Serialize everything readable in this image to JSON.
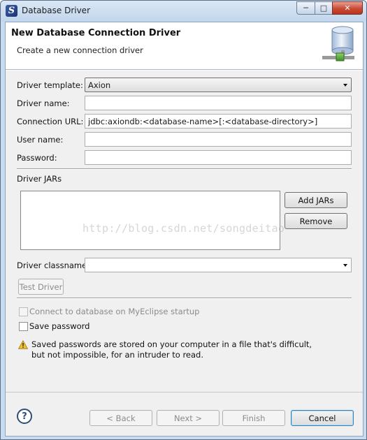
{
  "window": {
    "title": "Database Driver",
    "minimize_symbol": "─",
    "maximize_symbol": "□",
    "close_symbol": "✕"
  },
  "header": {
    "title": "New Database Connection Driver",
    "description": "Create a new connection driver",
    "icon": "database-connection-icon"
  },
  "form": {
    "driver_template": {
      "label": "Driver template:",
      "value": "Axion"
    },
    "driver_name": {
      "label": "Driver name:",
      "value": ""
    },
    "connection_url": {
      "label": "Connection URL:",
      "value": "jdbc:axiondb:<database-name>[:<database-directory>]"
    },
    "user_name": {
      "label": "User name:",
      "value": ""
    },
    "password": {
      "label": "Password:",
      "value": ""
    },
    "driver_jars": {
      "label": "Driver JARs",
      "add_label": "Add JARs",
      "remove_label": "Remove"
    },
    "driver_classname": {
      "label": "Driver classname:",
      "value": ""
    },
    "test_driver_label": "Test Driver",
    "connect_on_startup": {
      "label": "Connect to database on MyEclipse startup",
      "checked": false,
      "enabled": false
    },
    "save_password": {
      "label": "Save password",
      "checked": false
    },
    "warning": {
      "icon": "warning-icon",
      "text": "Saved passwords are stored on your computer in a file that's difficult, but not impossible, for an intruder to read."
    }
  },
  "watermark": "http://blog.csdn.net/songdeitao",
  "footer": {
    "help_symbol": "?",
    "back_label": "< Back",
    "next_label": "Next >",
    "finish_label": "Finish",
    "cancel_label": "Cancel"
  },
  "colors": {
    "title_bar": "#c9dbef",
    "close_button": "#c94a33",
    "warning": "#f2c12e"
  }
}
